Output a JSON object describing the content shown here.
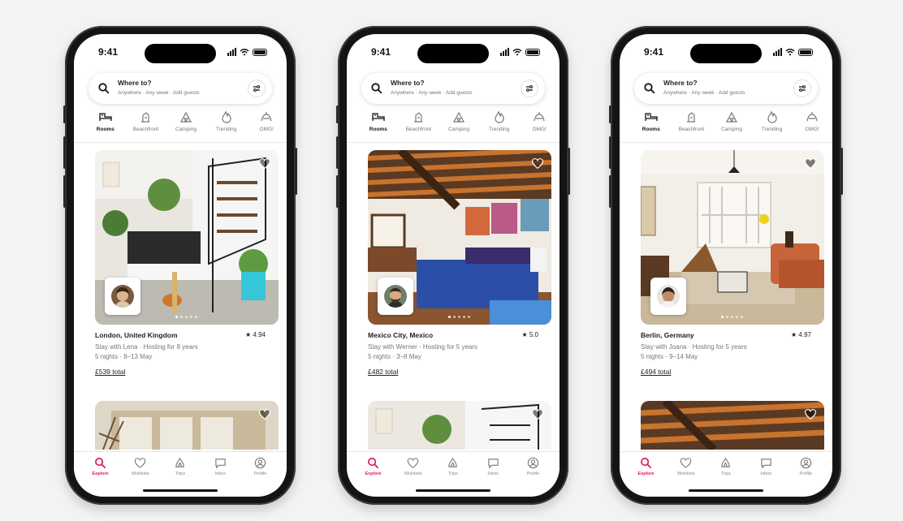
{
  "accent_color": "#e1145a",
  "phones": [
    {
      "time": "9:41",
      "search": {
        "title": "Where to?",
        "subtitle": "Anywhere · Any week · Add guests"
      },
      "categories": [
        "Rooms",
        "Beachfront",
        "Camping",
        "Trending",
        "OMG!"
      ],
      "listing": {
        "location": "London, United Kingdom",
        "rating": "★ 4.94",
        "host_line": "Stay with Lena · Hosting for 8 years",
        "dates": "5 nights · 8–13 May",
        "price": "£539 total"
      },
      "tabs": [
        "Explore",
        "Wishlists",
        "Trips",
        "Inbox",
        "Profile"
      ]
    },
    {
      "time": "9:41",
      "search": {
        "title": "Where to?",
        "subtitle": "Anywhere · Any week · Add guests"
      },
      "categories": [
        "Rooms",
        "Beachfront",
        "Camping",
        "Trending",
        "OMG!"
      ],
      "listing": {
        "location": "Mexico City, Mexico",
        "rating": "★ 5.0",
        "host_line": "Stay with Werner · Hosting for 5 years",
        "dates": "5 nights · 3–8 May",
        "price": "£482 total"
      },
      "tabs": [
        "Explore",
        "Wishlists",
        "Trips",
        "Inbox",
        "Profile"
      ]
    },
    {
      "time": "9:41",
      "search": {
        "title": "Where to?",
        "subtitle": "Anywhere · Any week · Add guests"
      },
      "categories": [
        "Rooms",
        "Beachfront",
        "Camping",
        "Trending",
        "OMG!"
      ],
      "listing": {
        "location": "Berlin, Germany",
        "rating": "★ 4.97",
        "host_line": "Stay with Joana · Hosting for 5 years",
        "dates": "5 nights · 9–14 May",
        "price": "£494 total"
      },
      "tabs": [
        "Explore",
        "Wishlists",
        "Trips",
        "Inbox",
        "Profile"
      ]
    }
  ]
}
